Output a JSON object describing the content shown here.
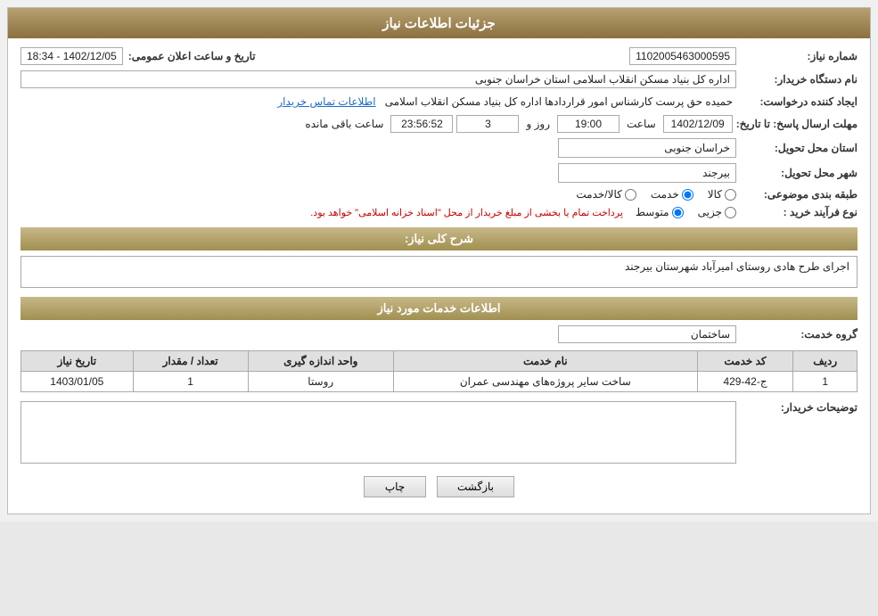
{
  "page": {
    "title": "جزئیات اطلاعات نیاز",
    "section_services": "اطلاعات خدمات مورد نیاز"
  },
  "header": {
    "title": "جزئیات اطلاعات نیاز"
  },
  "fields": {
    "need_number_label": "شماره نیاز:",
    "need_number_value": "1102005463000595",
    "buyer_org_label": "نام دستگاه خریدار:",
    "buyer_org_value": "اداره کل بنیاد مسکن انقلاب اسلامی استان خراسان جنوبی",
    "creator_label": "ایجاد کننده درخواست:",
    "creator_value": "حمیده حق پرست کارشناس امور قراردادها اداره کل بنیاد مسکن انقلاب اسلامی",
    "creator_link": "اطلاعات تماس خریدار",
    "deadline_label": "مهلت ارسال پاسخ: تا تاریخ:",
    "deadline_date": "1402/12/09",
    "deadline_time_label": "ساعت",
    "deadline_time": "19:00",
    "deadline_day_label": "روز و",
    "deadline_days": "3",
    "deadline_remaining_label": "ساعت باقی مانده",
    "deadline_remaining": "23:56:52",
    "province_label": "استان محل تحویل:",
    "province_value": "خراسان جنوبی",
    "city_label": "شهر محل تحویل:",
    "city_value": "بیرجند",
    "category_label": "طبقه بندی موضوعی:",
    "category_options": [
      "کالا",
      "خدمت",
      "کالا/خدمت"
    ],
    "category_selected": "خدمت",
    "process_label": "نوع فرآیند خرید :",
    "process_options": [
      "جزیی",
      "متوسط"
    ],
    "process_note": "پرداخت تمام یا بخشی از مبلغ خریدار از محل \"اسناد خزانه اسلامی\" خواهد بود.",
    "description_label": "شرح کلی نیاز:",
    "description_value": "اجرای طرح هادی روستای امیرآباد شهرستان بیرجند",
    "announce_label": "تاریخ و ساعت اعلان عمومی:",
    "announce_value": "1402/12/05 - 18:34",
    "services_section": "اطلاعات خدمات مورد نیاز",
    "service_group_label": "گروه خدمت:",
    "service_group_value": "ساختمان",
    "table": {
      "headers": [
        "ردیف",
        "کد خدمت",
        "نام خدمت",
        "واحد اندازه گیری",
        "تعداد / مقدار",
        "تاریخ نیاز"
      ],
      "rows": [
        {
          "row": "1",
          "code": "ج-42-429",
          "name": "ساخت سایر پروژه‌های مهندسی عمران",
          "unit": "روستا",
          "quantity": "1",
          "date": "1403/01/05"
        }
      ]
    },
    "buyer_notes_label": "توضیحات خریدار:",
    "buyer_notes_value": "",
    "btn_back": "بازگشت",
    "btn_print": "چاپ"
  }
}
